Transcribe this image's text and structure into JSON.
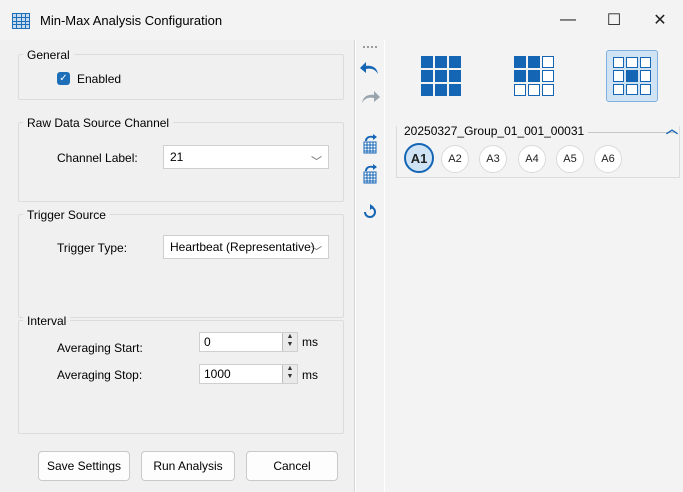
{
  "window": {
    "title": "Min-Max Analysis Configuration",
    "minimize_glyph": "—",
    "maximize_glyph": "☐",
    "close_glyph": "✕"
  },
  "general": {
    "title": "General",
    "enabled_label": "Enabled",
    "enabled_checked": true
  },
  "raw_data": {
    "title": "Raw Data Source Channel",
    "channel_label": "Channel Label:",
    "channel_value": "21"
  },
  "trigger": {
    "title": "Trigger Source",
    "type_label": "Trigger Type:",
    "type_value": "Heartbeat (Representative)"
  },
  "interval": {
    "title": "Interval",
    "start_label": "Averaging Start:",
    "start_value": "0",
    "stop_label": "Averaging Stop:",
    "stop_value": "1000",
    "unit": "ms"
  },
  "buttons": {
    "save": "Save Settings",
    "run": "Run Analysis",
    "cancel": "Cancel"
  },
  "toolbar": {
    "icons": [
      "undo-icon",
      "redo-icon",
      "grid-upload-icon",
      "grid-download-icon",
      "refresh-icon"
    ]
  },
  "right": {
    "layouts": [
      "grid-3x3-filled-icon",
      "grid-3x3-partial-icon",
      "grid-3x3-outline-icon"
    ],
    "selected_layout": 2,
    "group_name": "20250327_Group_01_001_00031",
    "wells": [
      "A1",
      "A2",
      "A3",
      "A4",
      "A5",
      "A6"
    ],
    "selected_well": "A1"
  },
  "colors": {
    "accent": "#1565b5",
    "selected_bg": "#cfe3f5"
  }
}
